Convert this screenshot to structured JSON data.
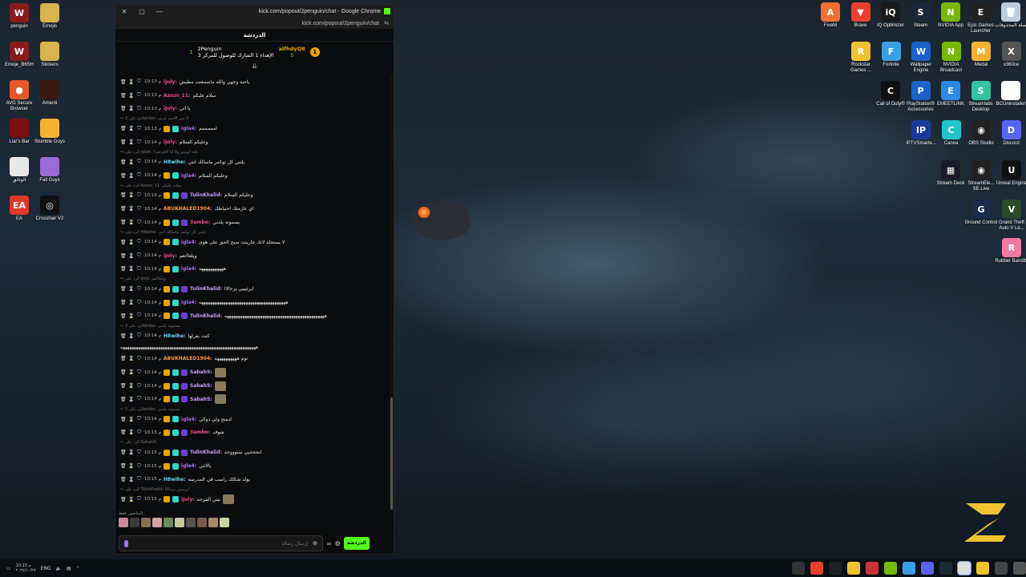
{
  "desktop": {
    "left_icons": [
      {
        "label": "penguin",
        "color": "#8b1a1a",
        "glyph": "W"
      },
      {
        "label": "Emojis",
        "color": "#d8b24a",
        "glyph": ""
      },
      {
        "label": "Emoje_B6SH",
        "color": "#8b1a1a",
        "glyph": "W"
      },
      {
        "label": "Stickers",
        "color": "#d8b24a",
        "glyph": ""
      },
      {
        "label": "AVG Secure Browser",
        "color": "#e8572a",
        "glyph": "●"
      },
      {
        "label": "Amenti",
        "color": "#3a1a10",
        "glyph": ""
      },
      {
        "label": "Liar's Bar",
        "color": "#7a1010",
        "glyph": ""
      },
      {
        "label": "Stumble Guys",
        "color": "#f2b230",
        "glyph": ""
      },
      {
        "label": "الوثائق",
        "color": "#e8e8e8",
        "glyph": ""
      },
      {
        "label": "Fall Guys",
        "color": "#9a6ad8",
        "glyph": ""
      },
      {
        "label": "EA",
        "color": "#e0382a",
        "glyph": "EA"
      },
      {
        "label": "Crosshair V2",
        "color": "#111111",
        "glyph": "◎"
      }
    ],
    "right_icons": [
      {
        "label": "FiveM",
        "color": "#f07030",
        "glyph": "A"
      },
      {
        "label": "Brave",
        "color": "#e8402a",
        "glyph": "▼"
      },
      {
        "label": "IQ Optimizer",
        "color": "#1a1a1a",
        "glyph": "iQ"
      },
      {
        "label": "Steam",
        "color": "#1b2838",
        "glyph": "S"
      },
      {
        "label": "NVIDIA App",
        "color": "#76b900",
        "glyph": "N"
      },
      {
        "label": "Epic Games Launcher",
        "color": "#222222",
        "glyph": "E"
      },
      {
        "label": "سلة المحذوفات",
        "color": "#bcd",
        "glyph": "🗑"
      },
      {
        "label": "Rockstar Games ...",
        "color": "#f2c230",
        "glyph": "R"
      },
      {
        "label": "Fortnite",
        "color": "#39a0e8",
        "glyph": "F"
      },
      {
        "label": "Wallpaper Engine",
        "color": "#1a62c8",
        "glyph": "W"
      },
      {
        "label": "NVIDIA Broadcast",
        "color": "#76b900",
        "glyph": "N"
      },
      {
        "label": "Medal",
        "color": "#f2b230",
        "glyph": "M"
      },
      {
        "label": "x360ce",
        "color": "#555555",
        "glyph": "X"
      },
      {
        "label": "Call of Duty®",
        "color": "#111111",
        "glyph": "C"
      },
      {
        "label": "PlayStation® Accessories",
        "color": "#1a62c8",
        "glyph": "P"
      },
      {
        "label": "EMEETLINK",
        "color": "#2a8ae8",
        "glyph": "E"
      },
      {
        "label": "Streamlabs Desktop",
        "color": "#31c3a2",
        "glyph": "S"
      },
      {
        "label": "BCUninstaller",
        "color": "#ffffff",
        "glyph": "B"
      },
      {
        "label": "IPTVSmarte...",
        "color": "#1a3a9a",
        "glyph": "IP"
      },
      {
        "label": "Canva",
        "color": "#20c4cb",
        "glyph": "C"
      },
      {
        "label": "OBS Studio",
        "color": "#222222",
        "glyph": "◉"
      },
      {
        "label": "Discord",
        "color": "#5865f2",
        "glyph": "D"
      },
      {
        "label": "Stream Deck",
        "color": "#1a1a2a",
        "glyph": "▦"
      },
      {
        "label": "StreamEle... SE.Live",
        "color": "#222222",
        "glyph": "◉"
      },
      {
        "label": "Unreal Engine",
        "color": "#111111",
        "glyph": "U"
      },
      {
        "label": "Ground Control",
        "color": "#1a2a4a",
        "glyph": "G"
      },
      {
        "label": "Grand Theft Auto V Le...",
        "color": "#2a4a2a",
        "glyph": "V"
      },
      {
        "label": "Rubber Bandits",
        "color": "#f07aa0",
        "glyph": "R"
      }
    ]
  },
  "window": {
    "title": "kick.com/popout/2penguin/chat - Google Chrome",
    "url": "kick.com/popout/2penguin/chat",
    "close": "✕",
    "maximize": "▢",
    "minimize": "—"
  },
  "chat": {
    "header": "الدردشة",
    "pinned": {
      "user": "alfhdyQ8",
      "user_count": "5",
      "streamer": "2Penguin",
      "streamer_count": "1",
      "message": "3 الإهداء 1 الشارك للوصول للمركز"
    },
    "messages": [
      {
        "reply": "",
        "time": "10:13 م",
        "user": "iJoly",
        "uc": "u-pink",
        "text": "ياحبه وجهي والله ماسمعتت مطيش",
        "badges": []
      },
      {
        "reply": "",
        "time": "10:13 م",
        "user": "Azozv_11",
        "uc": "u-pink",
        "text": "سلام عليكم",
        "badges": []
      },
      {
        "reply": "",
        "time": "10:13 م",
        "user": "iJoly",
        "uc": "u-pink",
        "text": "يا اثي",
        "badges": []
      },
      {
        "reply": "الرد على 3ambo: لا بس الاسم غريب",
        "time": "10:13 م",
        "user": "igla4",
        "uc": "u-purple",
        "text": "امممممم",
        "badges": [
          "gold",
          "teal"
        ]
      },
      {
        "reply": "",
        "time": "10:14 م",
        "user": "iJoly",
        "uc": "u-pink",
        "text": "وعليكم السلام",
        "badges": []
      },
      {
        "reply": "الرد على igla4: عله ابويش ولا انا الاقرعيه؟",
        "time": "10:14 م",
        "user": "H8wihe",
        "uc": "u-teal",
        "text": "يلتني كل توكمر ماسالك انتي",
        "badges": []
      },
      {
        "reply": "",
        "time": "10:14 م",
        "user": "igla4",
        "uc": "u-purple",
        "text": "وعليكم السلام",
        "badges": [
          "gold",
          "teal"
        ]
      },
      {
        "reply": "الرد على Azozv_11: سلام عليكم",
        "time": "10:14 م",
        "user": "TulinKhalid",
        "uc": "u-lav",
        "text": "وعليكم السلام",
        "badges": [
          "gold",
          "teal",
          "sub"
        ]
      },
      {
        "reply": "",
        "time": "10:14 م",
        "user": "ABUKHALED1904",
        "uc": "u-orange",
        "text": "اي عازمتك احتياطك",
        "badges": []
      },
      {
        "reply": "",
        "time": "10:14 م",
        "user": "3ambo",
        "uc": "u-pink",
        "text": "يسموته يلدني",
        "badges": [
          "gold",
          "teal",
          "sub"
        ]
      },
      {
        "reply": "الرد على H8wihe: يلتني كل توكمر ماسالك انتي",
        "time": "10:14 م",
        "user": "igla4",
        "uc": "u-purple",
        "text": "لا يستحله لانك جارينت سبح الحق على هوى",
        "badges": [
          "gold",
          "teal"
        ]
      },
      {
        "reply": "",
        "time": "10:14 م",
        "user": "iJoly",
        "uc": "u-pink",
        "text": "ويلعااتعم",
        "badges": []
      },
      {
        "reply": "",
        "time": "10:14 م",
        "user": "igla4",
        "uc": "u-purple",
        "text": "هههههههههههه",
        "badges": [
          "gold",
          "teal"
        ]
      },
      {
        "reply": "الرد على iJoly: ويلعااتعم",
        "time": "10:14 م",
        "user": "TulinKhalid",
        "uc": "u-lav",
        "text": "ابرثيييي يزحالاا",
        "badges": [
          "gold",
          "teal",
          "sub"
        ]
      },
      {
        "reply": "",
        "time": "10:14 م",
        "user": "igla4",
        "uc": "u-purple",
        "text": "هههههههههههههههههههههههههههههههههههههههه",
        "badges": [
          "gold",
          "teal"
        ]
      },
      {
        "reply": "",
        "time": "10:14 م",
        "user": "TulinKhalid",
        "uc": "u-lav",
        "text": "هههههههههههههههههههههههههههههههههههههههههههههه",
        "badges": [
          "gold",
          "teal",
          "sub"
        ]
      },
      {
        "reply": "الرد على 3ambo: يسموته يلدني",
        "time": "10:14 م",
        "user": "H8wihe",
        "uc": "u-teal",
        "text": "كنت بقرلها",
        "badges": []
      },
      {
        "wrap": "هههههههههههههههههههههههههههههههههههههههههههههههههههههههههههههه"
      },
      {
        "reply": "",
        "time": "10:14 م",
        "user": "ABUKHALED1904",
        "uc": "u-orange",
        "text": "نوم ههههههههههه",
        "badges": []
      },
      {
        "reply": "",
        "time": "10:14 م",
        "user": "Sabah5",
        "uc": "u-lav",
        "text": "",
        "emote": true,
        "badges": [
          "gold",
          "teal",
          "sub"
        ]
      },
      {
        "reply": "",
        "time": "10:14 م",
        "user": "Sabah5",
        "uc": "u-lav",
        "text": "",
        "emote": true,
        "badges": [
          "gold",
          "teal",
          "sub"
        ]
      },
      {
        "reply": "",
        "time": "10:14 م",
        "user": "Sabah5",
        "uc": "u-lav",
        "text": "",
        "emote": true,
        "badges": [
          "gold",
          "teal",
          "sub"
        ]
      },
      {
        "reply": "الرد على 3ambo: يسموته يلدني",
        "time": "10:14 م",
        "user": "igla4",
        "uc": "u-purple",
        "text": "ادمنج ولي دوالي",
        "badges": [
          "gold",
          "teal"
        ]
      },
      {
        "reply": "",
        "time": "10:15 م",
        "user": "3ambo",
        "uc": "u-pink",
        "text": "شوف",
        "badges": [
          "gold",
          "teal",
          "sub"
        ]
      },
      {
        "reply": "الرد على Sabah5:",
        "time": "10:15 م",
        "user": "TulinKhalid",
        "uc": "u-lav",
        "text": "ابحححيي سبوووجه",
        "badges": [
          "gold",
          "teal",
          "sub"
        ]
      },
      {
        "reply": "",
        "time": "10:15 م",
        "user": "igla4",
        "uc": "u-purple",
        "text": "يالاثني",
        "badges": [
          "gold",
          "teal"
        ]
      },
      {
        "reply": "",
        "time": "10:15 م",
        "user": "H8wihe",
        "uc": "u-teal",
        "text": "يولد شكلك راسب في المدرسه",
        "badges": []
      },
      {
        "reply": "الرد على TulinKhalid: ابرثيييي يزحالاا",
        "time": "10:15 م",
        "user": "iJoly",
        "uc": "u-pink",
        "text": "نيتي المزحه",
        "badges": [
          "gold",
          "teal"
        ],
        "emote": true
      }
    ],
    "recent_emotes_label": "المتابعون فقط",
    "input_placeholder": "إرسال رسالة",
    "chat_button": "الدردشة"
  },
  "taskbar": {
    "lang": "ENG",
    "time": "10:15 م",
    "date": "٢٠٢٤/١٠/٢٧"
  }
}
